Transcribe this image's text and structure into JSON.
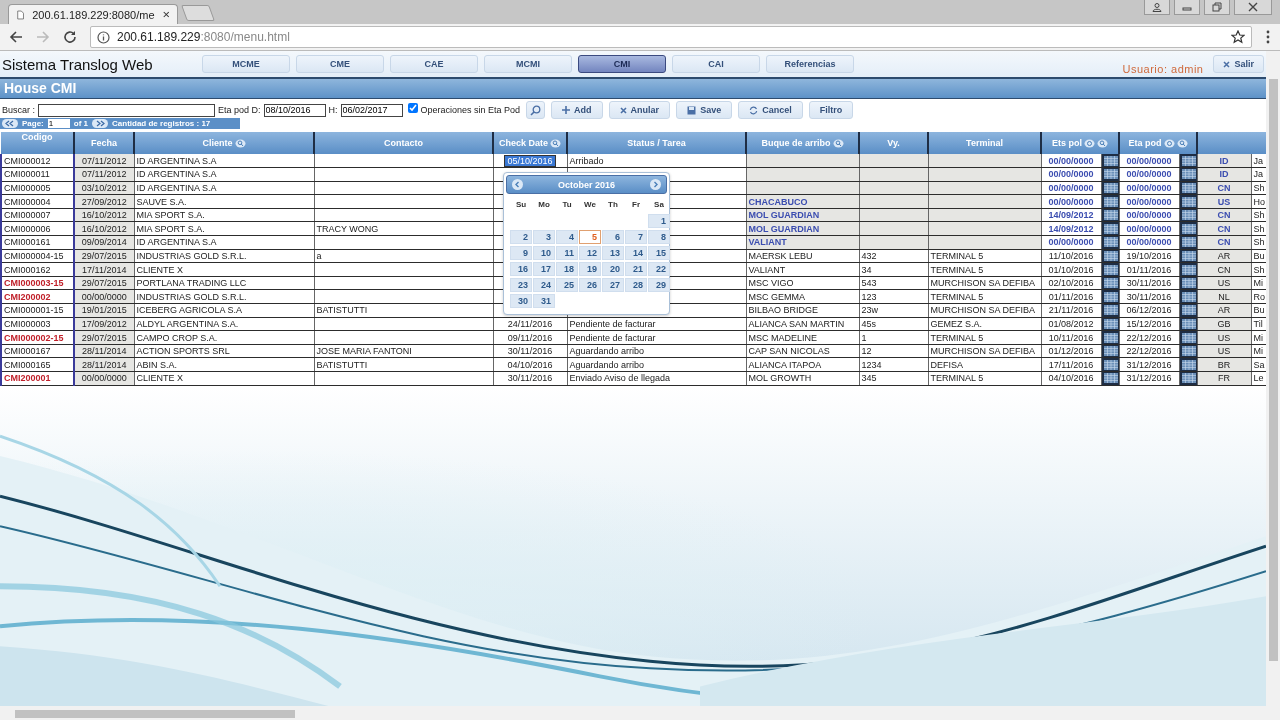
{
  "browser": {
    "tab_title": "200.61.189.229:8080/me",
    "url_host": "200.61.189.229",
    "url_rest": ":8080/menu.html"
  },
  "app": {
    "title": "Sistema Translog Web",
    "user": "Usuario: admin",
    "logout": "Salir",
    "nav": [
      {
        "label": "MCME",
        "selected": false
      },
      {
        "label": "CME",
        "selected": false
      },
      {
        "label": "CAE",
        "selected": false
      },
      {
        "label": "MCMI",
        "selected": false
      },
      {
        "label": "CMI",
        "selected": true
      },
      {
        "label": "CAI",
        "selected": false
      },
      {
        "label": "Referencias",
        "selected": false
      }
    ]
  },
  "page_title": "House CMI",
  "toolbar": {
    "search_label": "Buscar :",
    "eta_from_label": "Eta pod D:",
    "eta_from": "08/10/2016",
    "eta_to_label": "H:",
    "eta_to": "06/02/2017",
    "no_eta": {
      "label": "Operaciones sin Eta Pod",
      "checked": true
    },
    "buttons": [
      {
        "label": "Add"
      },
      {
        "label": "Anular"
      },
      {
        "label": "Save"
      },
      {
        "label": "Cancel"
      },
      {
        "label": "Filtro"
      }
    ]
  },
  "pager": {
    "page_label": "Page:",
    "page": "1",
    "of": "of 1",
    "count": "Cantidad de registros : 17"
  },
  "table": {
    "columns": [
      {
        "label": "Codigo"
      },
      {
        "label": "Fecha"
      },
      {
        "label": "Cliente",
        "search": true
      },
      {
        "label": "Contacto",
        "search": false
      },
      {
        "label": "Check Date",
        "search": true
      },
      {
        "label": "Status / Tarea",
        "search": false
      },
      {
        "label": "Buque de arribo",
        "search": true
      },
      {
        "label": "Vy.",
        "search": false
      },
      {
        "label": "Terminal",
        "search": false
      },
      {
        "label": "Ets pol",
        "search": true
      },
      {
        "label": "Eta pod",
        "search": true
      }
    ],
    "rows": [
      {
        "code": "CMI000012",
        "alert": false,
        "kind": "preliminary",
        "selected": true,
        "date": "07/11/2012",
        "client": "ID ARGENTINA S.A",
        "check_date": "05/10/2016",
        "status": "Arribado",
        "eta_pol": "00/00/0000",
        "eta_pod": "00/00/0000",
        "country": "ID",
        "column_13": "Ja"
      },
      {
        "code": "CMI000011",
        "alert": false,
        "kind": "preliminary",
        "selected": false,
        "date": "07/11/2012",
        "client": "ID ARGENTINA S.A",
        "eta_pol": "00/00/0000",
        "eta_pod": "00/00/0000",
        "country": "ID",
        "column_13": "Ja"
      },
      {
        "code": "CMI000005",
        "alert": false,
        "kind": "preliminary",
        "selected": false,
        "date": "03/10/2012",
        "client": "ID ARGENTINA S.A",
        "eta_pol": "00/00/0000",
        "eta_pod": "00/00/0000",
        "country": "CN",
        "column_13": "Sh"
      },
      {
        "code": "CMI000004",
        "alert": false,
        "kind": "preliminary",
        "selected": false,
        "date": "27/09/2012",
        "client": "SAUVE S.A.",
        "vessel": "CHACABUCO",
        "eta_pol": "00/00/0000",
        "eta_pod": "00/00/0000",
        "country": "US",
        "column_13": "Ho"
      },
      {
        "code": "CMI000007",
        "alert": false,
        "kind": "preliminary",
        "selected": false,
        "date": "16/10/2012",
        "client": "MIA SPORT S.A.",
        "vessel": "MOL GUARDIAN",
        "eta_pol": "14/09/2012",
        "eta_pod": "00/00/0000",
        "country": "CN",
        "column_13": "Sh"
      },
      {
        "code": "CMI000006",
        "alert": false,
        "kind": "preliminary",
        "selected": false,
        "date": "16/10/2012",
        "client": "MIA SPORT S.A.",
        "contact": "TRACY WONG",
        "vessel": "MOL GUARDIAN",
        "eta_pol": "14/09/2012",
        "eta_pod": "00/00/0000",
        "country": "CN",
        "column_13": "Sh"
      },
      {
        "code": "CMI000161",
        "alert": false,
        "kind": "preliminary",
        "selected": false,
        "date": "09/09/2014",
        "client": "ID ARGENTINA S.A",
        "vessel": "VALIANT",
        "eta_pol": "00/00/0000",
        "eta_pod": "00/00/0000",
        "country": "CN",
        "column_13": "Sh"
      },
      {
        "code": "CMI000004-15",
        "alert": false,
        "kind": "confirmed",
        "selected": false,
        "date": "29/07/2015",
        "client": "INDUSTRIAS GOLD S.R.L.",
        "contact": "a",
        "vessel": "MAERSK LEBU",
        "voyage": "432",
        "terminal": "TERMINAL 5",
        "eta_pol": "11/10/2016",
        "eta_pod": "19/10/2016",
        "country": "AR",
        "column_13": "Bu"
      },
      {
        "code": "CMI000162",
        "alert": false,
        "kind": "confirmed",
        "selected": false,
        "date": "17/11/2014",
        "client": "CLIENTE X",
        "vessel": "VALIANT",
        "voyage": "34",
        "terminal": "TERMINAL 5",
        "eta_pol": "01/10/2016",
        "eta_pod": "01/11/2016",
        "country": "CN",
        "column_13": "Sh"
      },
      {
        "code": "CMI000003-15",
        "alert": true,
        "kind": "confirmed",
        "selected": false,
        "date": "29/07/2015",
        "client": "PORTLANA TRADING LLC",
        "vessel": "MSC VIGO",
        "voyage": "543",
        "terminal": "MURCHISON SA DEFIBA",
        "eta_pol": "02/10/2016",
        "eta_pod": "30/11/2016",
        "country": "US",
        "column_13": "Mi"
      },
      {
        "code": "CMI200002",
        "alert": true,
        "kind": "confirmed",
        "selected": false,
        "date": "00/00/0000",
        "client": "INDUSTRIAS GOLD S.R.L.",
        "vessel": "MSC GEMMA",
        "voyage": "123",
        "terminal": "TERMINAL 5",
        "eta_pol": "01/11/2016",
        "eta_pod": "30/11/2016",
        "country": "NL",
        "column_13": "Ro"
      },
      {
        "code": "CMI000001-15",
        "alert": false,
        "kind": "confirmed",
        "selected": false,
        "date": "19/01/2015",
        "client": "ICEBERG AGRICOLA S.A",
        "contact": "BATISTUTTI",
        "vessel": "BILBAO BRIDGE",
        "voyage": "23w",
        "terminal": "MURCHISON SA DEFIBA",
        "eta_pol": "21/11/2016",
        "eta_pod": "06/12/2016",
        "country": "AR",
        "column_13": "Bu"
      },
      {
        "code": "CMI000003",
        "alert": false,
        "kind": "confirmed",
        "selected": false,
        "date": "17/09/2012",
        "client": "ALDYL ARGENTINA S.A.",
        "check_date": "24/11/2016",
        "status": "Pendiente de facturar",
        "vessel": "ALIANCA SAN MARTIN",
        "voyage": "45s",
        "terminal": "GEMEZ S.A.",
        "eta_pol": "01/08/2012",
        "eta_pod": "15/12/2016",
        "country": "GB",
        "column_13": "Til"
      },
      {
        "code": "CMI000002-15",
        "alert": true,
        "kind": "confirmed",
        "selected": false,
        "date": "29/07/2015",
        "client": "CAMPO CROP S.A.",
        "check_date": "09/11/2016",
        "status": "Pendiente de facturar",
        "vessel": "MSC MADELINE",
        "voyage": "1",
        "terminal": "TERMINAL 5",
        "eta_pol": "10/11/2016",
        "eta_pod": "22/12/2016",
        "country": "US",
        "column_13": "Mi"
      },
      {
        "code": "CMI000167",
        "alert": false,
        "kind": "confirmed",
        "selected": false,
        "date": "28/11/2014",
        "client": "ACTION SPORTS SRL",
        "contact": "JOSE MARIA FANTONI",
        "check_date": "30/11/2016",
        "status": "Aguardando arribo",
        "vessel": "CAP SAN NICOLAS",
        "voyage": "12",
        "terminal": "MURCHISON SA DEFIBA",
        "eta_pol": "01/12/2016",
        "eta_pod": "22/12/2016",
        "country": "US",
        "column_13": "Mi"
      },
      {
        "code": "CMI000165",
        "alert": false,
        "kind": "confirmed",
        "selected": false,
        "date": "28/11/2014",
        "client": "ABIN S.A.",
        "contact": "BATISTUTTI",
        "check_date": "04/10/2016",
        "status": "Aguardando arribo",
        "vessel": "ALIANCA ITAPOA",
        "voyage": "1234",
        "terminal": "DEFISA",
        "eta_pol": "17/11/2016",
        "eta_pod": "31/12/2016",
        "country": "BR",
        "column_13": "Sa"
      },
      {
        "code": "CMI200001",
        "alert": true,
        "kind": "confirmed",
        "selected": false,
        "date": "00/00/0000",
        "client": "CLIENTE X",
        "check_date": "30/11/2016",
        "status": "Enviado Aviso de llegada",
        "vessel": "MOL GROWTH",
        "voyage": "345",
        "terminal": "TERMINAL 5",
        "eta_pol": "04/10/2016",
        "eta_pod": "31/12/2016",
        "country": "FR",
        "column_13": "Le"
      }
    ]
  },
  "calendar": {
    "month": "October 2016",
    "weekdays": [
      "Su",
      "Mo",
      "Tu",
      "We",
      "Th",
      "Fr",
      "Sa"
    ],
    "weeks": [
      [
        {
          "day": "1",
          "today": false
        }
      ],
      [
        {
          "day": "2",
          "today": false
        },
        {
          "day": "3",
          "today": false
        },
        {
          "day": "4",
          "today": false
        },
        {
          "day": "5",
          "today": true
        },
        {
          "day": "6",
          "today": false
        },
        {
          "day": "7",
          "today": false
        },
        {
          "day": "8",
          "today": false
        }
      ],
      [
        {
          "day": "9",
          "today": false
        },
        {
          "day": "10",
          "today": false
        },
        {
          "day": "11",
          "today": false
        },
        {
          "day": "12",
          "today": false
        },
        {
          "day": "13",
          "today": false
        },
        {
          "day": "14",
          "today": false
        },
        {
          "day": "15",
          "today": false
        }
      ],
      [
        {
          "day": "16",
          "today": false
        },
        {
          "day": "17",
          "today": false
        },
        {
          "day": "18",
          "today": false
        },
        {
          "day": "19",
          "today": false
        },
        {
          "day": "20",
          "today": false
        },
        {
          "day": "21",
          "today": false
        },
        {
          "day": "22",
          "today": false
        }
      ],
      [
        {
          "day": "23",
          "today": false
        },
        {
          "day": "24",
          "today": false
        },
        {
          "day": "25",
          "today": false
        },
        {
          "day": "26",
          "today": false
        },
        {
          "day": "27",
          "today": false
        },
        {
          "day": "28",
          "today": false
        },
        {
          "day": "29",
          "today": false
        }
      ],
      [
        {
          "day": "30",
          "today": false
        },
        {
          "day": "31",
          "today": false
        }
      ]
    ]
  }
}
